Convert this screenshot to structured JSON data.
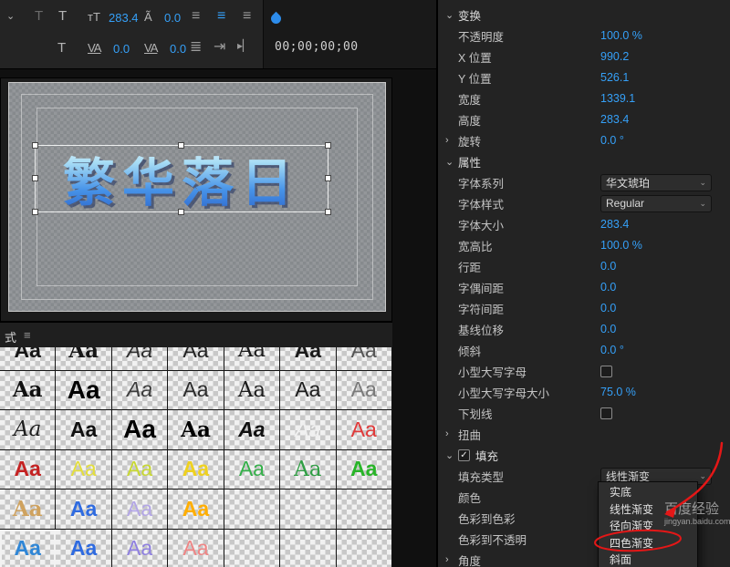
{
  "colors": {
    "value_blue": "#35a0f8",
    "accent_blue": "#2d8ceb",
    "annotation_red": "#e41717"
  },
  "icons": {
    "chevron_down": "⌄",
    "chevron_right": "›",
    "text_tool": "T",
    "font_size": "тT",
    "leading": "Ã",
    "kerning": "VA",
    "tracking": "VA",
    "align": "≡",
    "justify": "≣",
    "tab": "⇥",
    "goto": "▸▏",
    "menu": "≡",
    "check": "✓"
  },
  "toolbar": {
    "font_size": "283.4",
    "leading": "0.0",
    "kerning": "0.0",
    "tracking": "0.0",
    "timecode": "00;00;00;00"
  },
  "monitor": {
    "title_text": "繁华落日"
  },
  "styles_panel": {
    "tab_label": "式",
    "sample_text": "Aa",
    "cells": [
      [
        {
          "c": "#161616",
          "b": 1
        },
        {
          "c": "#161616",
          "b": 1,
          "f": "serif"
        },
        {
          "c": "#2e2e2e",
          "i": 1
        },
        {
          "c": "#222222"
        },
        {
          "c": "#1a1a1a",
          "f": "serif"
        },
        {
          "c": "#1a1a1a",
          "b": 1
        },
        {
          "c": "#555555"
        }
      ],
      [
        {
          "c": "#0f0f0f",
          "b": 1,
          "f": "serif"
        },
        {
          "c": "#000000",
          "b": 1,
          "lg": 1
        },
        {
          "c": "#3c3c3c",
          "i": 1
        },
        {
          "c": "#2b2b2b",
          "lt": 1
        },
        {
          "c": "#1c1c1c",
          "f": "serif"
        },
        {
          "c": "#1c1c1c"
        },
        {
          "c": "#7a7a7a",
          "lt": 1
        }
      ],
      [
        {
          "c": "#1e1e1e",
          "i": 1,
          "f": "serif"
        },
        {
          "c": "#101010",
          "b": 1
        },
        {
          "c": "#000000",
          "b": 1,
          "lg": 1
        },
        {
          "c": "#000000",
          "b": 1,
          "f": "serif"
        },
        {
          "c": "#101010",
          "b": 1,
          "i": 1
        },
        {
          "c": "#f0f0f0",
          "i": 1
        },
        {
          "c": "#e03a3a"
        }
      ],
      [
        {
          "c": "#c42222",
          "b": 1
        },
        {
          "c": "#e3de3d"
        },
        {
          "c": "#c8d832"
        },
        {
          "c": "#efd11f",
          "b": 1
        },
        {
          "c": "#35b04a"
        },
        {
          "c": "#2f9e44",
          "f": "serif"
        },
        {
          "c": "#28b428",
          "b": 1
        }
      ],
      [
        {
          "c": "#cfa25e",
          "b": 1,
          "f": "serif"
        },
        {
          "c": "#2f6be0",
          "b": 1
        },
        {
          "c": "#b3a6e6"
        },
        {
          "c": "#ffae00",
          "b": 1
        },
        {
          "e": 1
        },
        {
          "e": 1
        },
        {
          "e": 1
        }
      ],
      [
        {
          "c": "#2f86d6",
          "b": 1,
          "sel": 1
        },
        {
          "c": "#2f6be0",
          "b": 1
        },
        {
          "c": "#8f80e0"
        },
        {
          "c": "#ef8585"
        },
        {
          "e": 1
        },
        {
          "e": 1
        },
        {
          "e": 1
        }
      ]
    ]
  },
  "properties": {
    "rows": [
      {
        "label": "变换",
        "type": "section",
        "arrow": "down"
      },
      {
        "label": "不透明度",
        "value": "100.0 %"
      },
      {
        "label": "X 位置",
        "value": "990.2"
      },
      {
        "label": "Y 位置",
        "value": "526.1"
      },
      {
        "label": "宽度",
        "value": "1339.1"
      },
      {
        "label": "高度",
        "value": "283.4"
      },
      {
        "label": "旋转",
        "value": "0.0 °",
        "arrow": "right"
      },
      {
        "label": "属性",
        "type": "section",
        "arrow": "down"
      },
      {
        "label": "字体系列",
        "control": "select",
        "value": "华文琥珀"
      },
      {
        "label": "字体样式",
        "control": "select",
        "value": "Regular"
      },
      {
        "label": "字体大小",
        "value": "283.4"
      },
      {
        "label": "宽高比",
        "value": "100.0 %"
      },
      {
        "label": "行距",
        "value": "0.0"
      },
      {
        "label": "字偶间距",
        "value": "0.0"
      },
      {
        "label": "字符间距",
        "value": "0.0"
      },
      {
        "label": "基线位移",
        "value": "0.0"
      },
      {
        "label": "倾斜",
        "value": "0.0 °"
      },
      {
        "label": "小型大写字母",
        "control": "checkbox",
        "checked": false
      },
      {
        "label": "小型大写字母大小",
        "value": "75.0 %"
      },
      {
        "label": "下划线",
        "control": "checkbox",
        "checked": false
      },
      {
        "label": "扭曲",
        "arrow": "right"
      },
      {
        "label": "填充",
        "type": "section",
        "arrow": "down",
        "control": "checkbox-inline",
        "checked": true
      },
      {
        "label": "填充类型",
        "control": "select",
        "value": "线性渐变"
      },
      {
        "label": "颜色",
        "control": "color"
      },
      {
        "label": "色彩到色彩"
      },
      {
        "label": "色彩到不透明"
      },
      {
        "label": "角度",
        "arrow": "right"
      }
    ]
  },
  "fill_menu": {
    "items": [
      "实底",
      "线性渐变",
      "径向渐变",
      "四色渐变",
      "斜面"
    ],
    "circled": "四色渐变"
  },
  "watermark": {
    "line1": "百度经验",
    "line2": "jingyan.baidu.com"
  }
}
